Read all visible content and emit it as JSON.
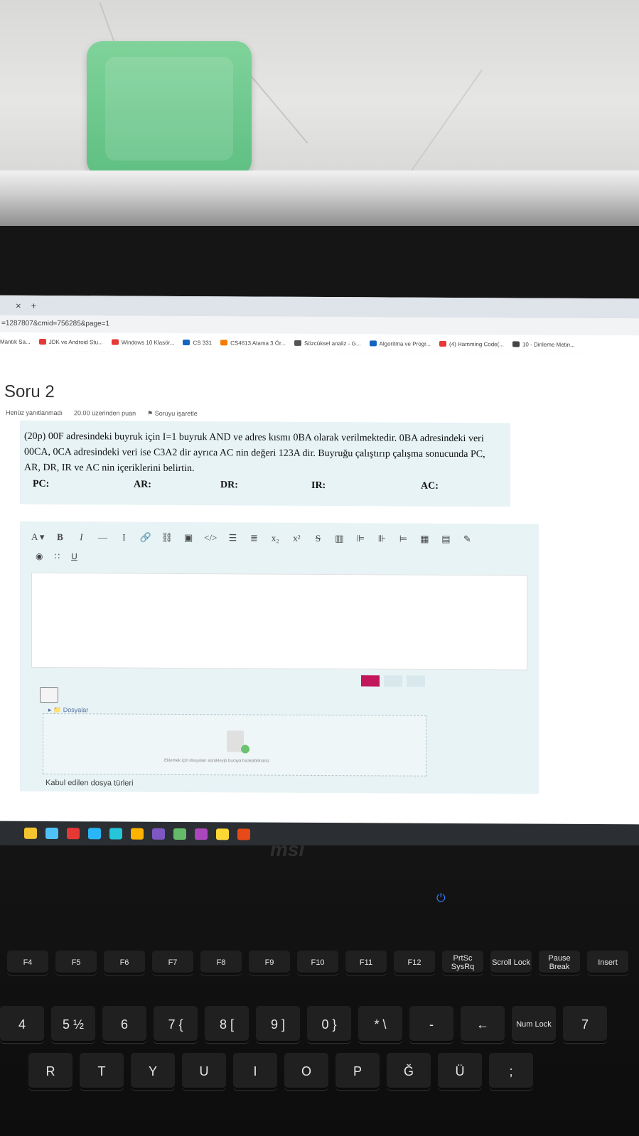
{
  "browser": {
    "tab_close": "×",
    "tab_new": "+",
    "url": "=1287807&cmid=756285&page=1",
    "bookmarks": [
      {
        "label": "Mantık Sa...",
        "color": "#1a73e8"
      },
      {
        "label": "JDK ve Android Stu...",
        "color": "#e53935"
      },
      {
        "label": "Windows 10 Klasör...",
        "color": "#e53935"
      },
      {
        "label": "CS 331",
        "color": "#1565c0"
      },
      {
        "label": "CS4613 Atama 3 Ör...",
        "color": "#f57c00"
      },
      {
        "label": "Sözcüksel analiz - G...",
        "color": "#555555"
      },
      {
        "label": "Algoritma ve Progr...",
        "color": "#1565c0"
      },
      {
        "label": "(4) Hamming Code(...",
        "color": "#e53935"
      },
      {
        "label": "10 - Dinleme Metin...",
        "color": "#444444"
      }
    ]
  },
  "question": {
    "title": "Soru 2",
    "status": "Henüz yanıtlanmadı",
    "points": "20.00 üzerinden puan",
    "flag": "Soruyu işaretle",
    "text": "(20p) 00F adresindeki buyruk için I=1 buyruk AND ve adres kısmı 0BA olarak verilmektedir. 0BA adresindeki veri 00CA, 0CA adresindeki veri ise C3A2 dir ayrıca AC nin değeri 123A dir. Buyruğu çalıştırıp çalışma sonucunda PC, AR, DR, IR ve AC nin içeriklerini belirtin.",
    "labels": [
      "PC:",
      "AR:",
      "DR:",
      "IR:",
      "AC:"
    ]
  },
  "editor": {
    "toolbar1": [
      "A ▾",
      "B",
      "I",
      "—",
      "I",
      "🔗",
      "⛓",
      "▣",
      "</>",
      "☰",
      "≣",
      "x₂",
      "x²",
      "S",
      "▥",
      "⊫",
      "⊪",
      "⊨",
      "▦",
      "▤",
      "✎"
    ],
    "toolbar2": [
      "◉",
      "∷",
      "U"
    ]
  },
  "files": {
    "folder": "Dosyalar",
    "drop_text": "Eklemek için dosyaları sürükleyip buraya bırakabilirsiniz",
    "accepted": "Kabul edilen dosya türleri"
  },
  "keyboard": {
    "brand": "msi",
    "fkeys": [
      "F4",
      "F5",
      "F6",
      "F7",
      "F8",
      "F9",
      "F10",
      "F11",
      "F12",
      "PrtSc SysRq",
      "Scroll Lock",
      "Pause Break",
      "Insert"
    ],
    "numkeys": [
      "4",
      "5 ½",
      "6",
      "7 {",
      "8 [",
      "9 ]",
      "0 }",
      "* \\",
      "-",
      "←",
      "Num Lock",
      "7"
    ],
    "letters": [
      "R",
      "T",
      "Y",
      "U",
      "I",
      "O",
      "P",
      "Ğ",
      "Ü",
      ";"
    ]
  }
}
